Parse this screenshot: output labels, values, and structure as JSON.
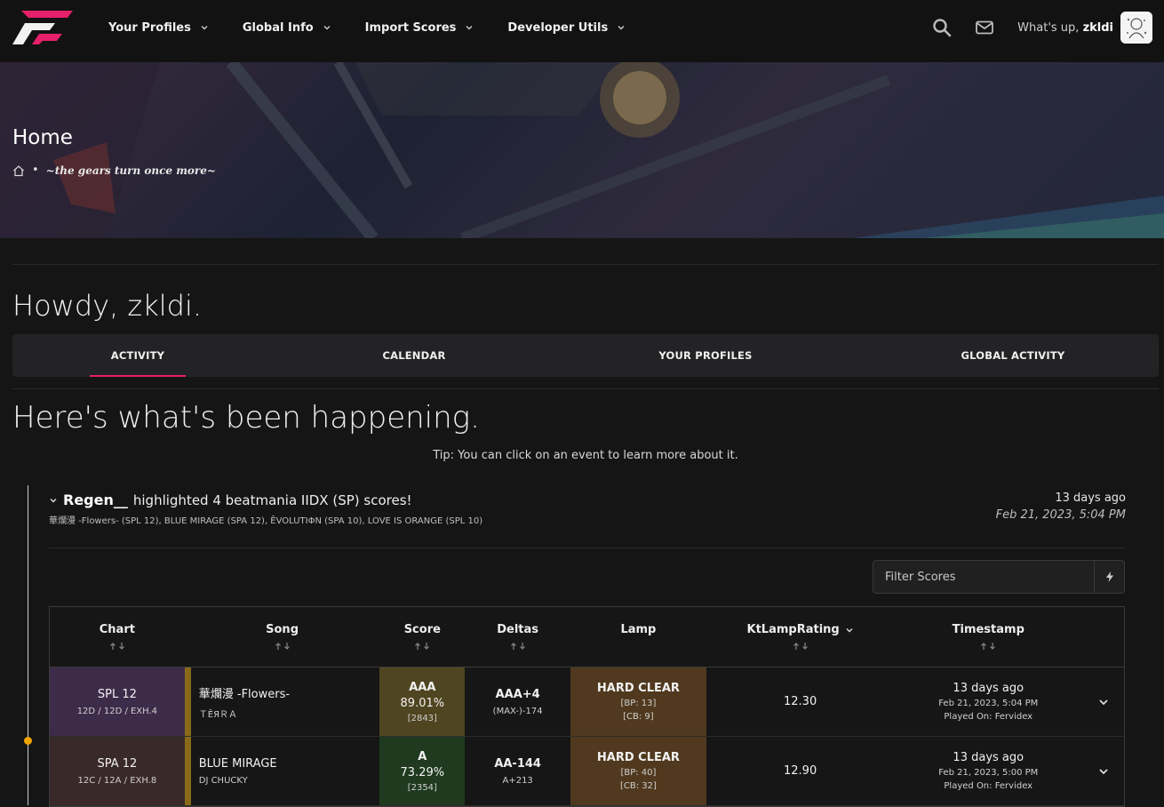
{
  "nav": {
    "items": [
      {
        "label": "Your Profiles"
      },
      {
        "label": "Global Info"
      },
      {
        "label": "Import Scores"
      },
      {
        "label": "Developer Utils"
      }
    ],
    "greeting_prefix": "What's up,",
    "username": "zkldi"
  },
  "banner": {
    "title": "Home",
    "tagline": "~the gears turn once more~"
  },
  "howdy": "Howdy, zkldi.",
  "tabs": [
    {
      "label": "ACTIVITY",
      "active": true
    },
    {
      "label": "CALENDAR",
      "active": false
    },
    {
      "label": "YOUR PROFILES",
      "active": false
    },
    {
      "label": "GLOBAL ACTIVITY",
      "active": false
    }
  ],
  "heading": "Here's what's been happening.",
  "tip": "Tip: You can click on an event to learn more about it.",
  "event": {
    "user": "Regen__",
    "text": "highlighted 4 beatmania IIDX (SP) scores!",
    "songs_summary": "華爛漫 -Flowers- (SPL 12), BLUE MIRAGE (SPA 12), ĒVOLUTIΦN (SPA 10), LOVE IS ORANGE (SPL 10)",
    "ago": "13 days ago",
    "timestamp": "Feb 21, 2023, 5:04 PM"
  },
  "filter": {
    "placeholder": "Filter Scores"
  },
  "table": {
    "headers": [
      "Chart",
      "Song",
      "Score",
      "Deltas",
      "Lamp",
      "KtLampRating",
      "Timestamp"
    ],
    "rows": [
      {
        "chart": "SPL 12",
        "chart_sub": "12D / 12D / EXH.4",
        "song": "華爛漫 -Flowers-",
        "artist": "ＴĒЯＲＡ",
        "grade": "AAA",
        "percent": "89.01%",
        "exscore": "[2843]",
        "delta": "AAA+4",
        "delta_sub": "(MAX-)-174",
        "lamp": "HARD CLEAR",
        "bp": "[BP: 13]",
        "cb": "[CB: 9]",
        "rating": "12.30",
        "ago": "13 days ago",
        "ts": "Feb 21, 2023, 5:04 PM",
        "played": "Played On: Fervidex"
      },
      {
        "chart": "SPA 12",
        "chart_sub": "12C / 12A / EXH.8",
        "song": "BLUE MIRAGE",
        "artist": "DJ CHUCKY",
        "grade": "A",
        "percent": "73.29%",
        "exscore": "[2354]",
        "delta": "AA-144",
        "delta_sub": "A+213",
        "lamp": "HARD CLEAR",
        "bp": "[BP: 40]",
        "cb": "[CB: 32]",
        "rating": "12.90",
        "ago": "13 days ago",
        "ts": "Feb 21, 2023, 5:00 PM",
        "played": "Played On: Fervidex"
      }
    ]
  },
  "colors": {
    "accent": "#e6206a",
    "timeline_dot": "#f0a500"
  }
}
